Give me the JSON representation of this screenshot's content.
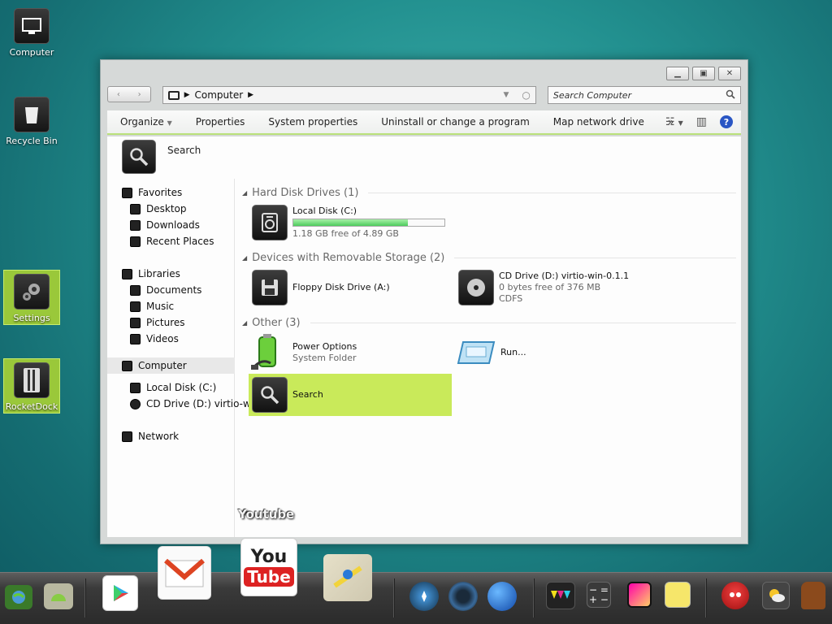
{
  "desktop": {
    "icons": [
      {
        "label": "Computer"
      },
      {
        "label": "Recycle Bin"
      },
      {
        "label": "Settings"
      },
      {
        "label": "RocketDock"
      }
    ]
  },
  "window": {
    "address": {
      "location": "Computer"
    },
    "search_placeholder": "Search Computer",
    "toolbar": {
      "organize": "Organize",
      "properties": "Properties",
      "system_properties": "System properties",
      "uninstall": "Uninstall or change a program",
      "map_drive": "Map network drive",
      "more": "»"
    },
    "search_header": "Search",
    "nav": {
      "favorites": "Favorites",
      "desktop": "Desktop",
      "downloads": "Downloads",
      "recent": "Recent Places",
      "libraries": "Libraries",
      "documents": "Documents",
      "music": "Music",
      "pictures": "Pictures",
      "videos": "Videos",
      "computer": "Computer",
      "local_disk": "Local Disk (C:)",
      "cd_drive": "CD Drive (D:) virtio-w",
      "network": "Network"
    },
    "groups": {
      "hdd": "Hard Disk Drives (1)",
      "removable": "Devices with Removable Storage (2)",
      "other": "Other (3)"
    },
    "items": {
      "local_disk": {
        "name": "Local Disk (C:)",
        "free": "1.18 GB free of 4.89 GB",
        "used_fraction": 0.76
      },
      "floppy": {
        "name": "Floppy Disk Drive (A:)"
      },
      "cd": {
        "name": "CD Drive (D:) virtio-win-0.1.1",
        "free": "0 bytes free of 376 MB",
        "fs": "CDFS"
      },
      "power": {
        "name": "Power Options",
        "sub": "System Folder"
      },
      "run": {
        "name": "Run..."
      },
      "search": {
        "name": "Search"
      }
    }
  },
  "dock": {
    "hover_label": "Youtube"
  }
}
